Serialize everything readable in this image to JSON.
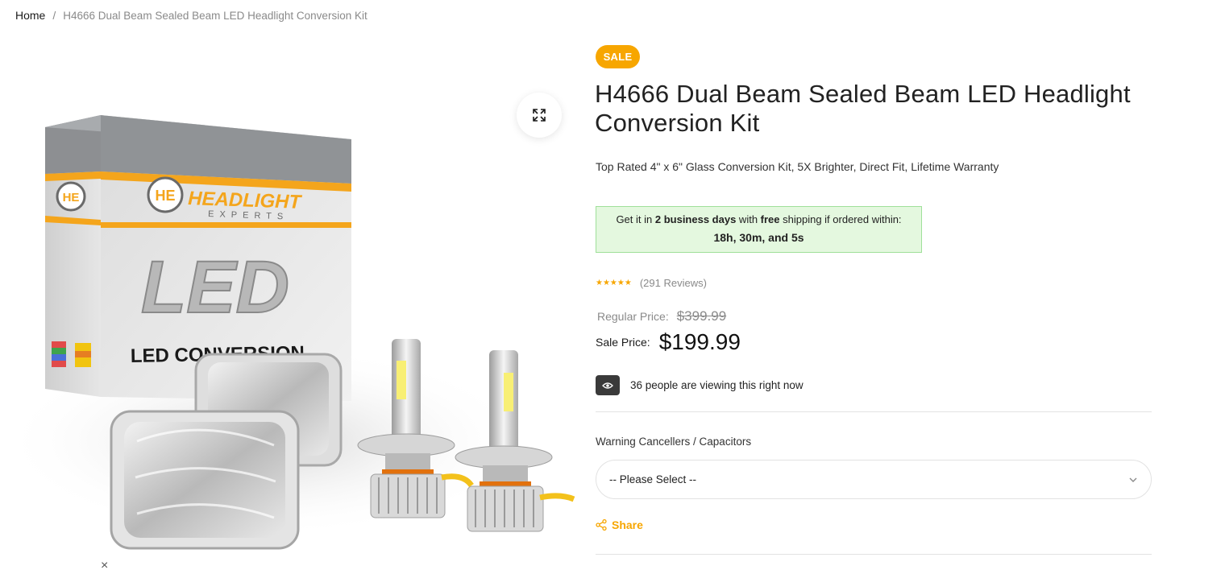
{
  "breadcrumb": {
    "home": "Home",
    "separator": "/",
    "current": "H4666 Dual Beam Sealed Beam LED Headlight Conversion Kit"
  },
  "gallery": {
    "box_brand_line1": "HEADLIGHT",
    "box_brand_line2": "EXPERTS",
    "box_logo": "HE",
    "box_big_text": "LED",
    "box_bottom_text": "LED CONVERSION",
    "close_symbol": "×"
  },
  "product": {
    "badge": "SALE",
    "title": "H4666 Dual Beam Sealed Beam LED Headlight Conversion Kit",
    "subtitle": "Top Rated 4\" x 6\" Glass Conversion Kit, 5X Brighter, Direct Fit, Lifetime Warranty",
    "shipping": {
      "prefix": "Get it in ",
      "days": "2 business days",
      "middle": " with ",
      "free": "free",
      "suffix": " shipping if ordered within:",
      "countdown": "18h, 30m, and 5s"
    },
    "rating": {
      "stars": "★★★★★",
      "value": 5,
      "reviews": "(291 Reviews)"
    },
    "price": {
      "regular_label": "Regular Price:",
      "regular": "$399.99",
      "sale_label": "Sale Price:",
      "sale": "$199.99"
    },
    "viewers": "36 people are viewing this right now",
    "option": {
      "label": "Warning Cancellers / Capacitors",
      "selected": "-- Please Select --"
    },
    "share": "Share"
  },
  "colors": {
    "accent": "#f7a600",
    "shipping_bg": "#e4f8df",
    "shipping_border": "#9fe09a",
    "muted": "#8a8a8a"
  },
  "icons": {
    "zoom": "expand-icon",
    "eye": "eye-icon",
    "chevron": "chevron-down-icon",
    "share": "share-icon",
    "close": "close-icon"
  }
}
